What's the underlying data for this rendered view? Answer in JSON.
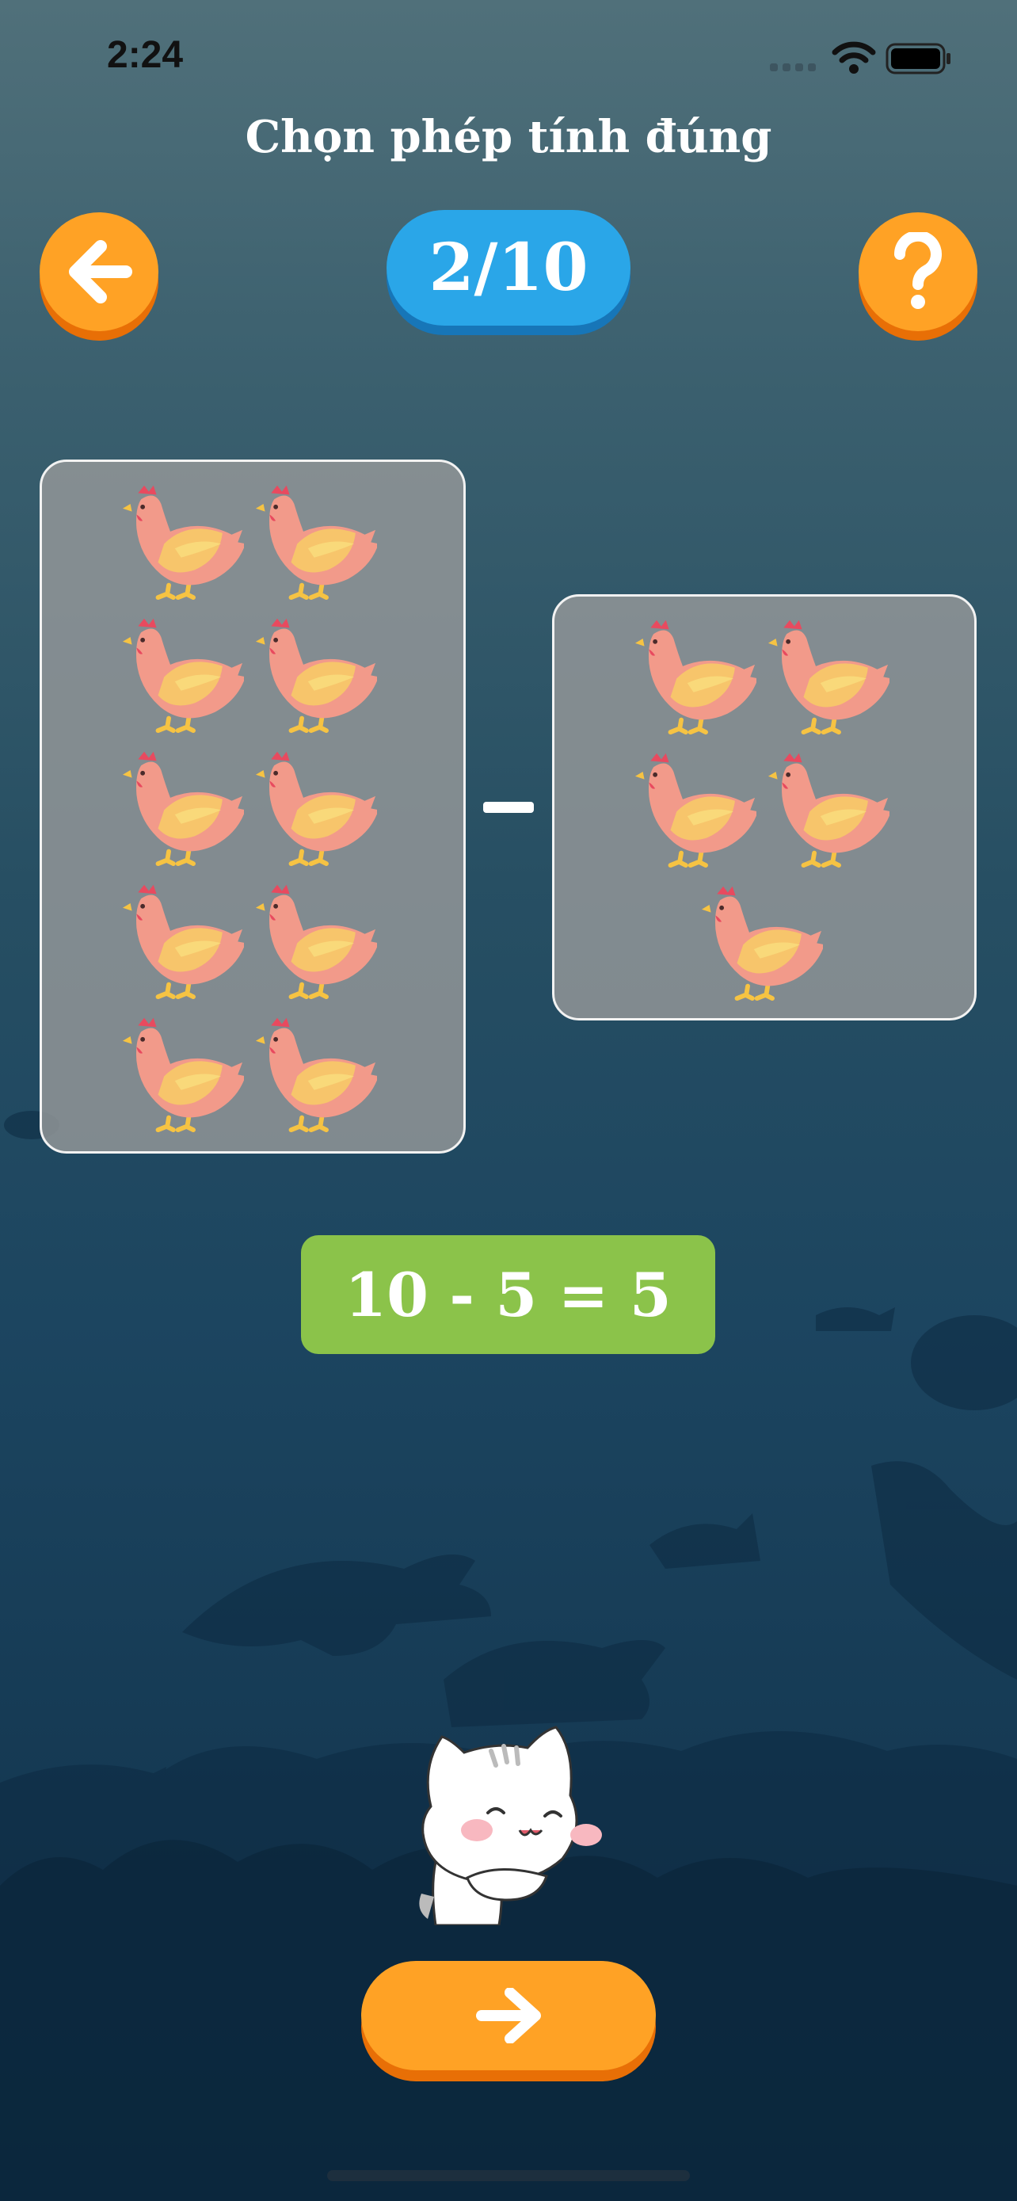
{
  "status_bar": {
    "time": "2:24"
  },
  "header": {
    "title": "Chọn phép tính đúng",
    "progress": "2/10"
  },
  "icons": {
    "back": "arrow-left-icon",
    "help": "question-mark-icon",
    "next": "arrow-right-icon",
    "item": "chicken-icon",
    "mascot": "cat-mascot"
  },
  "problem": {
    "left_count": 10,
    "right_count": 5,
    "operator": "-"
  },
  "answer": {
    "text": "10 - 5 = 5"
  },
  "colors": {
    "orange": "#ffa225",
    "blue": "#2aa6e8",
    "green": "#8bc34a"
  }
}
